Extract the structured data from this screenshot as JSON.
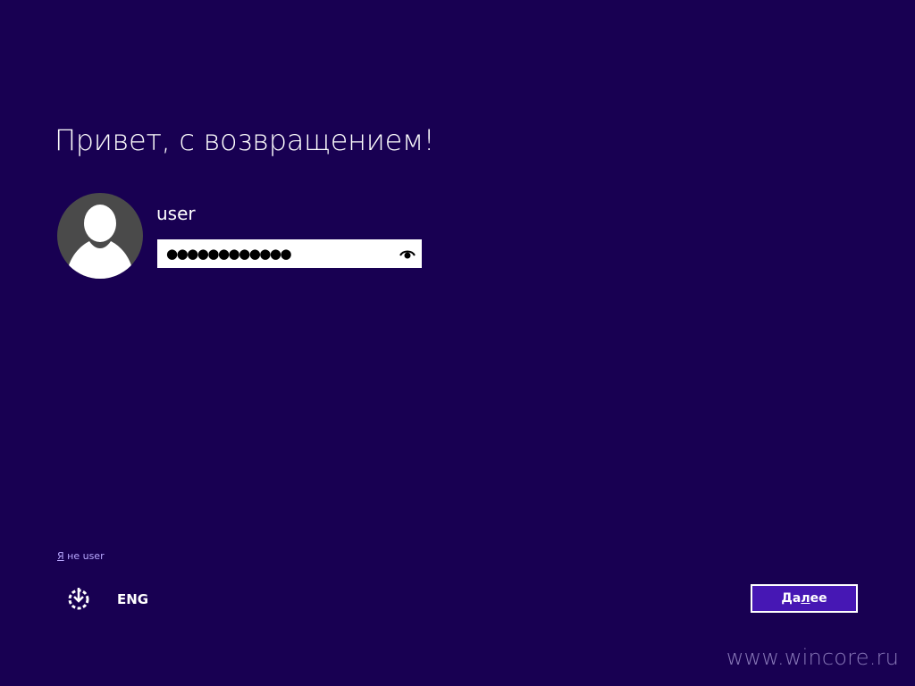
{
  "greeting": "Привет, с возвращением!",
  "user": {
    "name": "user",
    "avatar_icon": "user-silhouette-icon"
  },
  "password": {
    "value": "●●●●●●●●●●●●",
    "reveal_icon": "eye-icon"
  },
  "not_user_link": {
    "hotkey": "Я",
    "rest": " не user"
  },
  "footer": {
    "ease_of_access_icon": "ease-of-access-icon",
    "language": "ENG"
  },
  "next_button": {
    "before": "Да",
    "hotkey": "л",
    "after": "ее"
  },
  "watermark": "www.wincore.ru",
  "colors": {
    "background": "#180052",
    "button": "#4617b4",
    "link": "#b9a8ff",
    "avatar_bg": "#4a4a4a"
  }
}
